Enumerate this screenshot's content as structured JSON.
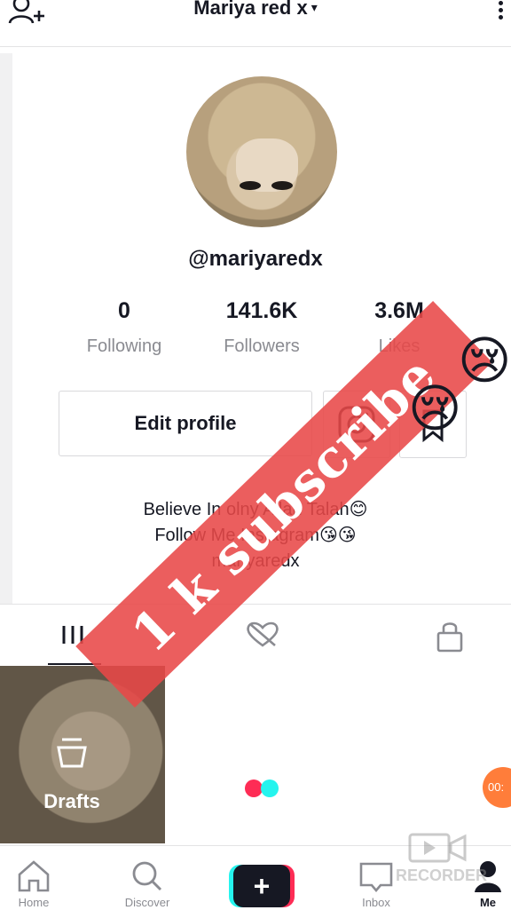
{
  "header": {
    "title": "Mariya red x",
    "caret": "▾"
  },
  "profile": {
    "username": "@mariyaredx"
  },
  "stats": [
    {
      "value": "0",
      "label": "Following"
    },
    {
      "value": "141.6K",
      "label": "Followers"
    },
    {
      "value": "3.6M",
      "label": "Likes"
    }
  ],
  "actions": {
    "edit_profile": "Edit profile"
  },
  "bio": {
    "line1": "Believe In olny Allah Talah😊",
    "line2": "Follow Me Instagram😘😘",
    "line3": "mariyaredx"
  },
  "drafts": {
    "label": "Drafts"
  },
  "timer": "00:",
  "bottom_nav": {
    "home": "Home",
    "discover": "Discover",
    "create": "+",
    "inbox": "Inbox",
    "me": "Me"
  },
  "overlay": {
    "banner": "1 k subscribe",
    "emoji_a": "😢",
    "emoji_b": "😢",
    "watermark": "RECORDER"
  },
  "colors": {
    "accent_red": "#fe2c55",
    "accent_cyan": "#25f4ee",
    "banner": "#e84848"
  }
}
